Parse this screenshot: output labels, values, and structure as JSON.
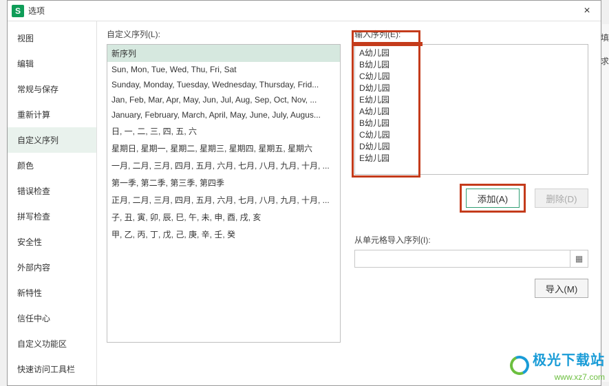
{
  "titlebar": {
    "app_icon_letter": "S",
    "title": "选项",
    "close_glyph": "×"
  },
  "sidebar": {
    "items": [
      {
        "label": "视图",
        "selected": false
      },
      {
        "label": "编辑",
        "selected": false
      },
      {
        "label": "常规与保存",
        "selected": false
      },
      {
        "label": "重新计算",
        "selected": false
      },
      {
        "label": "自定义序列",
        "selected": true
      },
      {
        "label": "颜色",
        "selected": false
      },
      {
        "label": "错误检查",
        "selected": false
      },
      {
        "label": "拼写检查",
        "selected": false
      },
      {
        "label": "安全性",
        "selected": false
      },
      {
        "label": "外部内容",
        "selected": false
      },
      {
        "label": "新特性",
        "selected": false
      },
      {
        "label": "信任中心",
        "selected": false
      },
      {
        "label": "自定义功能区",
        "selected": false
      },
      {
        "label": "快速访问工具栏",
        "selected": false
      }
    ]
  },
  "custom_list": {
    "label": "自定义序列(L):",
    "items": [
      "新序列",
      "Sun, Mon, Tue, Wed, Thu, Fri, Sat",
      "Sunday, Monday, Tuesday, Wednesday, Thursday, Frid...",
      "Jan, Feb, Mar, Apr, May, Jun, Jul, Aug, Sep, Oct, Nov, ...",
      "January, February, March, April, May, June, July, Augus...",
      "日, 一, 二, 三, 四, 五, 六",
      "星期日, 星期一, 星期二, 星期三, 星期四, 星期五, 星期六",
      "一月, 二月, 三月, 四月, 五月, 六月, 七月, 八月, 九月, 十月, ...",
      "第一季, 第二季, 第三季, 第四季",
      "正月, 二月, 三月, 四月, 五月, 六月, 七月, 八月, 九月, 十月, ...",
      "子, 丑, 寅, 卯, 辰, 巳, 午, 未, 申, 酉, 戌, 亥",
      "甲, 乙, 丙, 丁, 戊, 己, 庚, 辛, 壬, 癸"
    ],
    "selected_index": 0
  },
  "input_seq": {
    "label": "输入序列(E):",
    "value": "A幼儿园\nB幼儿园\nC幼儿园\nD幼儿园\nE幼儿园\nA幼儿园\nB幼儿园\nC幼儿园\nD幼儿园\nE幼儿园"
  },
  "buttons": {
    "add": "添加(A)",
    "delete": "删除(D)",
    "import": "导入(M)"
  },
  "import_section": {
    "label": "从单元格导入序列(I):",
    "value": "",
    "range_icon_glyph": "▦"
  },
  "right_edge": {
    "tag1": "填",
    "tag2": "求"
  },
  "watermark": {
    "line1": "极光下载站",
    "line2": "www.xz7.com"
  }
}
